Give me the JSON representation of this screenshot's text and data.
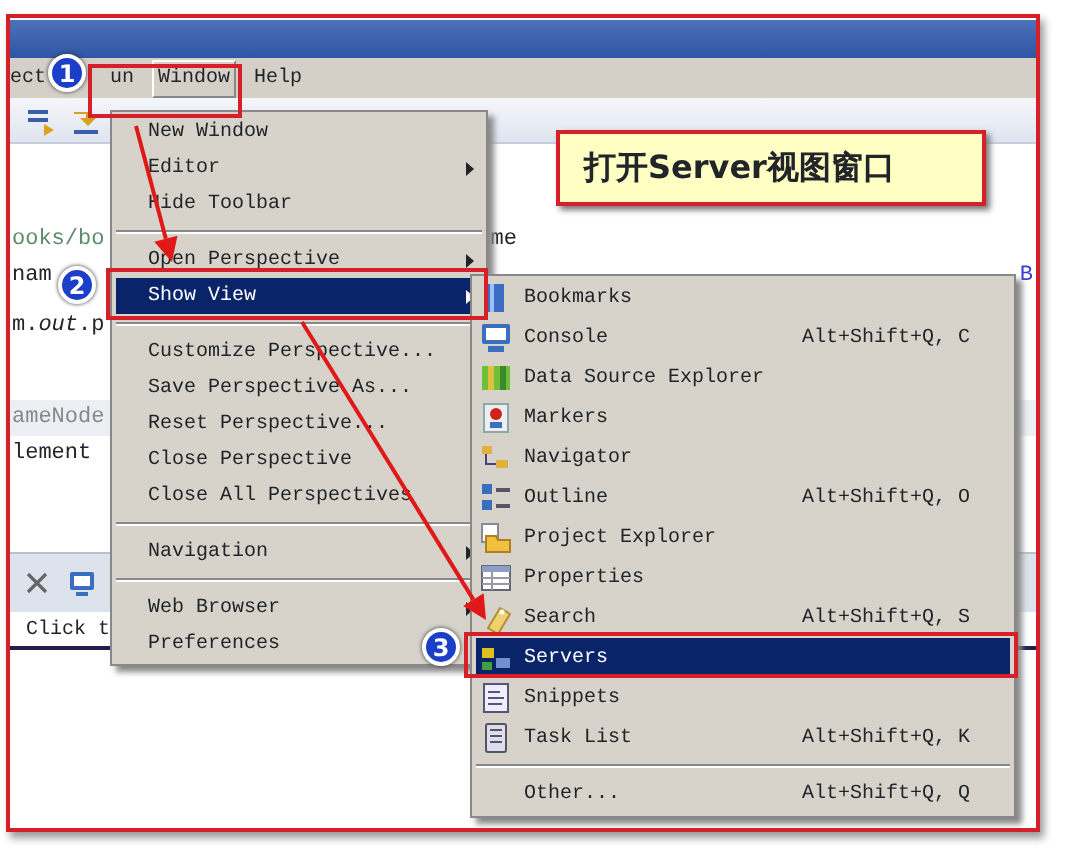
{
  "menu_bar": [
    {
      "label": "ect",
      "selected": false
    },
    {
      "label": "un",
      "selected": false
    },
    {
      "label": "Window",
      "selected": true
    },
    {
      "label": "Help",
      "selected": false
    }
  ],
  "editor_lines": [
    {
      "text": "ooks/bo",
      "tail": "me",
      "kind": "path"
    },
    {
      "text": "nam",
      "tail": "B",
      "kind": "plain"
    },
    {
      "text": "m.*out*.p",
      "kind": "plain"
    },
    {
      "text": "ameNode",
      "kind": "comment"
    },
    {
      "text": "lement",
      "kind": "plain"
    }
  ],
  "bottom_panel": {
    "text": "Click t"
  },
  "window_menu": [
    {
      "kind": "item",
      "label": "New Window",
      "submenu": false,
      "selected": false
    },
    {
      "kind": "item",
      "label": "Editor",
      "submenu": true,
      "selected": false
    },
    {
      "kind": "item",
      "label": "Hide Toolbar",
      "submenu": false,
      "selected": false
    },
    {
      "kind": "separator"
    },
    {
      "kind": "item",
      "label": "Open Perspective",
      "submenu": true,
      "selected": false
    },
    {
      "kind": "item",
      "label": "Show View",
      "submenu": true,
      "selected": true
    },
    {
      "kind": "separator"
    },
    {
      "kind": "item",
      "label": "Customize Perspective...",
      "submenu": false,
      "selected": false
    },
    {
      "kind": "item",
      "label": "Save Perspective As...",
      "submenu": false,
      "selected": false
    },
    {
      "kind": "item",
      "label": "Reset Perspective...",
      "submenu": false,
      "selected": false
    },
    {
      "kind": "item",
      "label": "Close Perspective",
      "submenu": false,
      "selected": false
    },
    {
      "kind": "item",
      "label": "Close All Perspectives",
      "submenu": false,
      "selected": false
    },
    {
      "kind": "separator"
    },
    {
      "kind": "item",
      "label": "Navigation",
      "submenu": true,
      "selected": false
    },
    {
      "kind": "separator"
    },
    {
      "kind": "item",
      "label": "Web Browser",
      "submenu": true,
      "selected": false
    },
    {
      "kind": "item",
      "label": "Preferences",
      "submenu": false,
      "selected": false
    }
  ],
  "show_view_menu": [
    {
      "kind": "item",
      "label": "Bookmarks",
      "selected": false
    },
    {
      "kind": "item",
      "label": "Console",
      "shortcut": "Alt+Shift+Q, C",
      "selected": false
    },
    {
      "kind": "item",
      "label": "Data Source Explorer",
      "selected": false
    },
    {
      "kind": "item",
      "label": "Markers",
      "selected": false
    },
    {
      "kind": "item",
      "label": "Navigator",
      "selected": false
    },
    {
      "kind": "item",
      "label": "Outline",
      "shortcut": "Alt+Shift+Q, O",
      "selected": false
    },
    {
      "kind": "item",
      "label": "Project Explorer",
      "selected": false
    },
    {
      "kind": "item",
      "label": "Properties",
      "selected": false
    },
    {
      "kind": "item",
      "label": "Search",
      "shortcut": "Alt+Shift+Q, S",
      "selected": false
    },
    {
      "kind": "item",
      "label": "Servers",
      "selected": true
    },
    {
      "kind": "item",
      "label": "Snippets",
      "selected": false
    },
    {
      "kind": "item",
      "label": "Task List",
      "shortcut": "Alt+Shift+Q, K",
      "selected": false
    },
    {
      "kind": "separator"
    },
    {
      "kind": "item",
      "label": "Other...",
      "shortcut": "Alt+Shift+Q, Q",
      "selected": false
    }
  ],
  "annotations": {
    "callout": "打开Server视图窗口",
    "steps": [
      "1",
      "2",
      "3"
    ]
  }
}
